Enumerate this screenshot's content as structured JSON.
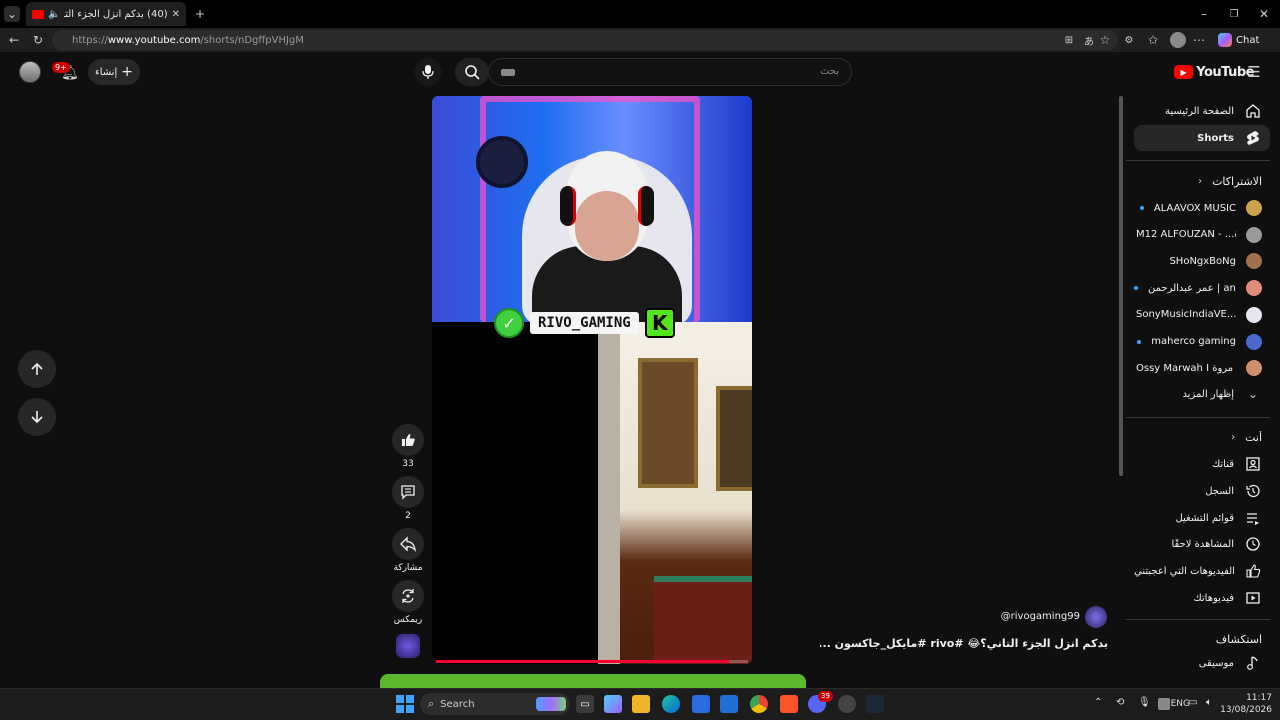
{
  "browser": {
    "tab_title": "(40) بدكم انزل الجزء التاني؟😂",
    "url_scheme": "https://",
    "url_host": "www.youtube.com",
    "url_path": "/shorts/nDgffpVHJgM",
    "chat_label": "Chat"
  },
  "header": {
    "logo_text": "YouTube",
    "search_placeholder": "بحث",
    "create_label": "إنشاء",
    "notification_count": "9+"
  },
  "video": {
    "overlay_handle": "RIVO_GAMING",
    "overlay_k": "K",
    "progress": 0.94,
    "channel_handle": "@rivogaming99",
    "title": "بدكم انزل الجزء التاني؟😂 #rivo #مايكل_جاكسون ..."
  },
  "actions": {
    "like_count": "33",
    "comment_count": "2",
    "share_label": "مشاركة",
    "remix_label": "ريمكس"
  },
  "sidebar": {
    "home_label": "الصفحة الرئيسية",
    "shorts_label": "Shorts",
    "subs_heading": "الاشتراكات",
    "channels": [
      {
        "name": "ALAAVOX MUSIC",
        "dot": true
      },
      {
        "name": "M12 ALFOUZAN - ...ة",
        "dot": false
      },
      {
        "name": "SHoNgxBoNg",
        "dot": false
      },
      {
        "name": "عمر عبدالرحمن | an...",
        "dot": true
      },
      {
        "name": "SonyMusicIndiaVE...",
        "dot": false
      },
      {
        "name": "maherco gaming",
        "dot": true
      },
      {
        "name": "Ossy Marwah I مروة ...",
        "dot": false
      }
    ],
    "show_more": "إظهار المزيد",
    "you_heading": "أنت",
    "you_items": [
      "قناتك",
      "السجل",
      "قوائم التشغيل",
      "المشاهدة لاحقًا",
      "الفيديوهات التي أعجبتني",
      "فيديوهاتك"
    ],
    "explore_heading": "استكشاف",
    "explore_items": [
      "موسيقى"
    ]
  },
  "taskbar": {
    "search_label": "Search",
    "lang": "ENG",
    "time": "11:17",
    "date": "13/08/2026",
    "discord_badge": "39"
  }
}
